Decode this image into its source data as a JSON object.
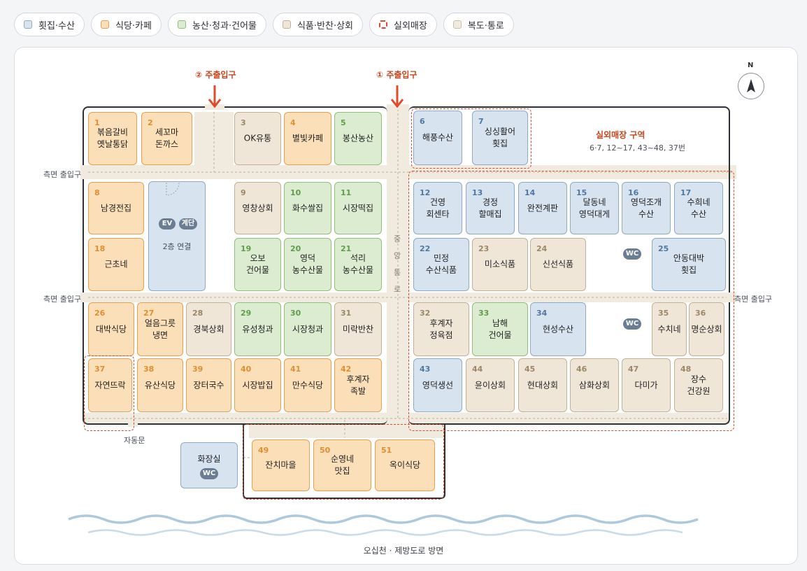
{
  "legend": [
    {
      "label": "횟집·수산",
      "color": "#d7e3ef",
      "border": "#8faac4"
    },
    {
      "label": "식당·카페",
      "color": "#fbdfb8",
      "border": "#e8a050"
    },
    {
      "label": "농산·청과·건어물",
      "color": "#dcecd0",
      "border": "#8fbf7a"
    },
    {
      "label": "식품·반찬·상회",
      "color": "#efe6d7",
      "border": "#c2b198"
    },
    {
      "label": "실외매장",
      "color": "dashed",
      "border": "#e04b2a"
    },
    {
      "label": "복도·통로",
      "color": "#f1ebdf",
      "border": "#c9bfa9"
    }
  ],
  "compass": {
    "label": "N"
  },
  "entrances": {
    "main1": "① 주출입구",
    "main2": "② 주출입구"
  },
  "side_entrance": "측면 출입구",
  "central_corridor": "중앙통로",
  "outdoor_zone": {
    "title": "실외매장 구역",
    "subtitle": "6·7, 12~17, 43~48, 37번"
  },
  "ev": {
    "ev": "EV",
    "stairs": "계단",
    "note": "2층 연결"
  },
  "wc": "WC",
  "toilet": {
    "label": "화장실",
    "badge": "WC"
  },
  "auto_door": "자동문",
  "bottom_label": "오십천 · 제방도로 방면",
  "stalls": [
    {
      "num": "1",
      "name": "볶음갈비\n옛날통닭",
      "cat": "food"
    },
    {
      "num": "2",
      "name": "세꼬마\n돈까스",
      "cat": "food"
    },
    {
      "num": "3",
      "name": "OK유통",
      "cat": "deli"
    },
    {
      "num": "4",
      "name": "별빛카페",
      "cat": "food"
    },
    {
      "num": "5",
      "name": "봉산농산",
      "cat": "farm"
    },
    {
      "num": "6",
      "name": "해풍수산",
      "cat": "sea"
    },
    {
      "num": "7",
      "name": "싱싱활어\n횟집",
      "cat": "sea"
    },
    {
      "num": "8",
      "name": "남경전집",
      "cat": "food"
    },
    {
      "num": "9",
      "name": "영창상회",
      "cat": "deli"
    },
    {
      "num": "10",
      "name": "화수쌀집",
      "cat": "farm"
    },
    {
      "num": "11",
      "name": "시장떡집",
      "cat": "farm"
    },
    {
      "num": "12",
      "name": "건영\n회센타",
      "cat": "sea"
    },
    {
      "num": "13",
      "name": "경정\n할매집",
      "cat": "sea"
    },
    {
      "num": "14",
      "name": "완전계판",
      "cat": "sea"
    },
    {
      "num": "15",
      "name": "달동네\n영덕대게",
      "cat": "sea"
    },
    {
      "num": "16",
      "name": "영덕조개\n수산",
      "cat": "sea"
    },
    {
      "num": "17",
      "name": "수희네\n수산",
      "cat": "sea"
    },
    {
      "num": "18",
      "name": "근초네",
      "cat": "food"
    },
    {
      "num": "19",
      "name": "오보\n건어물",
      "cat": "farm"
    },
    {
      "num": "20",
      "name": "영덕\n농수산물",
      "cat": "farm"
    },
    {
      "num": "21",
      "name": "석리\n농수산물",
      "cat": "farm"
    },
    {
      "num": "22",
      "name": "민정\n수산식품",
      "cat": "sea"
    },
    {
      "num": "23",
      "name": "미소식품",
      "cat": "deli"
    },
    {
      "num": "24",
      "name": "신선식품",
      "cat": "deli"
    },
    {
      "num": "25",
      "name": "안동대박\n횟집",
      "cat": "sea"
    },
    {
      "num": "26",
      "name": "대박식당",
      "cat": "food"
    },
    {
      "num": "27",
      "name": "얼음그릇\n냉면",
      "cat": "food"
    },
    {
      "num": "28",
      "name": "경북상회",
      "cat": "deli"
    },
    {
      "num": "29",
      "name": "유성청과",
      "cat": "farm"
    },
    {
      "num": "30",
      "name": "시장청과",
      "cat": "farm"
    },
    {
      "num": "31",
      "name": "미락반찬",
      "cat": "deli"
    },
    {
      "num": "32",
      "name": "후계자\n정육점",
      "cat": "deli"
    },
    {
      "num": "33",
      "name": "남해\n건어물",
      "cat": "farm"
    },
    {
      "num": "34",
      "name": "현성수산",
      "cat": "sea"
    },
    {
      "num": "35",
      "name": "수치네",
      "cat": "deli"
    },
    {
      "num": "36",
      "name": "명순상회",
      "cat": "deli"
    },
    {
      "num": "37",
      "name": "자연뜨락",
      "cat": "food"
    },
    {
      "num": "38",
      "name": "유산식당",
      "cat": "food"
    },
    {
      "num": "39",
      "name": "장터국수",
      "cat": "food"
    },
    {
      "num": "40",
      "name": "시장밥집",
      "cat": "food"
    },
    {
      "num": "41",
      "name": "만수식당",
      "cat": "food"
    },
    {
      "num": "42",
      "name": "후계자\n족발",
      "cat": "food"
    },
    {
      "num": "43",
      "name": "영덕생선",
      "cat": "sea"
    },
    {
      "num": "44",
      "name": "윤이상회",
      "cat": "deli"
    },
    {
      "num": "45",
      "name": "현대상회",
      "cat": "deli"
    },
    {
      "num": "46",
      "name": "삼화상회",
      "cat": "deli"
    },
    {
      "num": "47",
      "name": "다미가",
      "cat": "deli"
    },
    {
      "num": "48",
      "name": "장수\n건강원",
      "cat": "deli"
    },
    {
      "num": "49",
      "name": "잔치마을",
      "cat": "food"
    },
    {
      "num": "50",
      "name": "순영네\n맛집",
      "cat": "food"
    },
    {
      "num": "51",
      "name": "옥이식당",
      "cat": "food"
    }
  ]
}
